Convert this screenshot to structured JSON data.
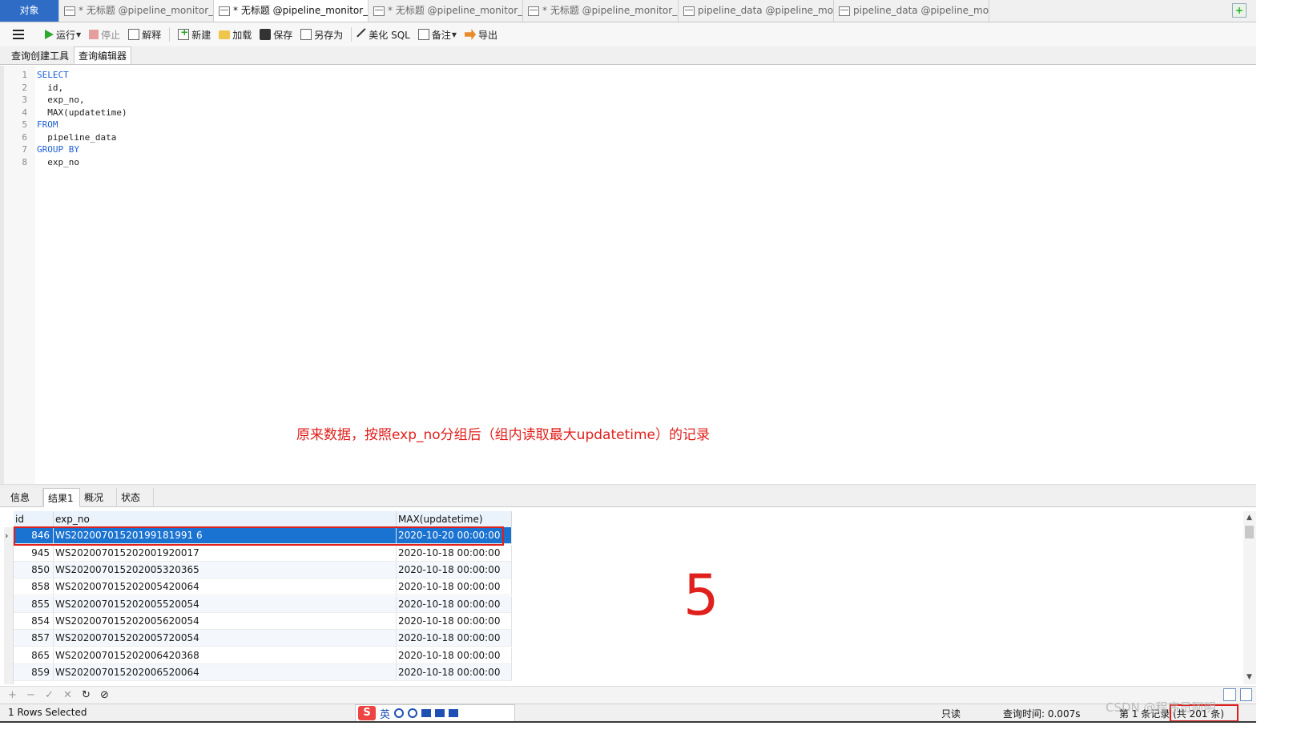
{
  "tabs": [
    {
      "label": "对象",
      "active": false
    },
    {
      "label": "* 无标题 @pipeline_monitor_...",
      "active": false
    },
    {
      "label": "* 无标题 @pipeline_monitor_...",
      "active": true
    },
    {
      "label": "* 无标题 @pipeline_monitor_...",
      "active": false
    },
    {
      "label": "* 无标题 @pipeline_monitor_...",
      "active": false
    },
    {
      "label": "pipeline_data @pipeline_mo...",
      "active": false
    },
    {
      "label": "pipeline_data @pipeline_mo...",
      "active": false
    }
  ],
  "toolbar": {
    "run": "运行",
    "stop": "停止",
    "explain": "解释",
    "new": "新建",
    "load": "加载",
    "save": "保存",
    "save_as": "另存为",
    "beautify": "美化 SQL",
    "comment": "备注",
    "export": "导出"
  },
  "subtabs": [
    "查询创建工具",
    "查询编辑器"
  ],
  "editor": {
    "lines": [
      {
        "no": "1",
        "text": "SELECT",
        "keyword": true
      },
      {
        "no": "2",
        "text": "  id,",
        "keyword": false
      },
      {
        "no": "3",
        "text": "  exp_no,",
        "keyword": false
      },
      {
        "no": "4",
        "text": "  MAX(updatetime)",
        "keyword": false
      },
      {
        "no": "5",
        "text": "FROM",
        "keyword": true
      },
      {
        "no": "6",
        "text": "  pipeline_data",
        "keyword": false
      },
      {
        "no": "7",
        "text": "GROUP BY",
        "keyword": true
      },
      {
        "no": "8",
        "text": "  exp_no",
        "keyword": false
      }
    ]
  },
  "annotation": "原来数据，按照exp_no分组后（组内读取最大updatetime）的记录",
  "result_tabs": [
    "信息",
    "结果1",
    "概况",
    "状态"
  ],
  "grid": {
    "columns": [
      "id",
      "exp_no",
      "MAX(updatetime)"
    ],
    "rows": [
      [
        "846",
        "WS20200701520199181991 6",
        "2020-10-20 00:00:00"
      ],
      [
        "945",
        "WS202007015202001920017",
        "2020-10-18 00:00:00"
      ],
      [
        "850",
        "WS202007015202005320365",
        "2020-10-18 00:00:00"
      ],
      [
        "858",
        "WS202007015202005420064",
        "2020-10-18 00:00:00"
      ],
      [
        "855",
        "WS202007015202005520054",
        "2020-10-18 00:00:00"
      ],
      [
        "854",
        "WS202007015202005620054",
        "2020-10-18 00:00:00"
      ],
      [
        "857",
        "WS202007015202005720054",
        "2020-10-18 00:00:00"
      ],
      [
        "865",
        "WS202007015202006420368",
        "2020-10-18 00:00:00"
      ],
      [
        "859",
        "WS202007015202006520064",
        "2020-10-18 00:00:00"
      ]
    ],
    "selected_row": 0,
    "marker": "5"
  },
  "footer_buttons": [
    "+",
    "−",
    "✓",
    "✕",
    "↻",
    "⊘"
  ],
  "status": {
    "rows_selected": "1 Rows Selected",
    "readonly": "只读",
    "query_time": "查询时间: 0.007s",
    "record": "第 1 条记录 (共 201 条)"
  },
  "ime": {
    "logo": "S",
    "lang": "英"
  },
  "watermark": "CSDN @程序员阿明",
  "colors": {
    "accent": "#1a73d1",
    "annotation": "#e0201c",
    "keyword": "#1f5fd6"
  }
}
